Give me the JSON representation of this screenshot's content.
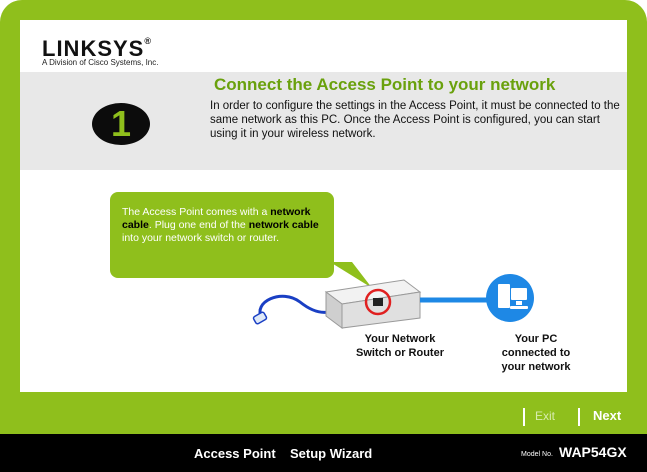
{
  "brand": {
    "logo": "LINKSYS",
    "logo_reg": "®",
    "subtitle": "A Division of Cisco Systems, Inc."
  },
  "step": {
    "number": "1"
  },
  "header": {
    "title": "Connect the Access Point to your network",
    "description": "In order to configure the settings in the Access Point, it must be connected to the same network as this PC. Once the Access Point is configured, you can start using it in your wireless network."
  },
  "callout": {
    "part1": "The Access Point comes with a ",
    "bold1": "network cable",
    "part2": ". Plug one end of the ",
    "bold2": "network cable",
    "part3": " into your network switch or router."
  },
  "diagram": {
    "switch_label_line1": "Your Network",
    "switch_label_line2": "Switch or Router",
    "pc_label_line1": "Your PC",
    "pc_label_line2": "connected to",
    "pc_label_line3": "your network"
  },
  "nav": {
    "exit_label": "Exit",
    "next_label": "Next"
  },
  "footer": {
    "product": "Access Point",
    "wizard": "Setup Wizard",
    "model_label": "Model No.",
    "model": "WAP54GX"
  },
  "colors": {
    "accent": "#8fbf1c",
    "title_green": "#6aa10d",
    "cable_blue": "#1a3fc4",
    "pc_blue": "#1e88e5"
  },
  "icons": [
    "linksys-logo",
    "step-number-badge",
    "ethernet-cable-icon",
    "network-switch-icon",
    "pc-icon"
  ]
}
